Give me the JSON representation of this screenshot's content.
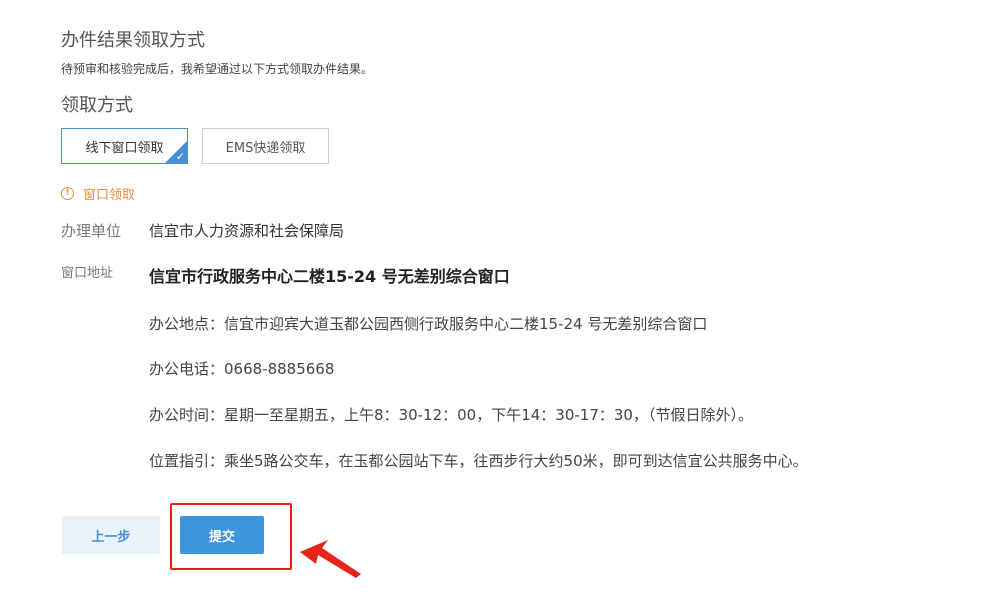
{
  "section": {
    "title": "办件结果领取方式",
    "description": "待预审和核验完成后，我希望通过以下方式领取办件结果。"
  },
  "pickup": {
    "label": "领取方式",
    "options": [
      {
        "label": "线下窗口领取",
        "selected": true
      },
      {
        "label": "EMS快递领取",
        "selected": false
      }
    ]
  },
  "notice": {
    "icon": "exclamation-circle-icon",
    "text": "窗口领取"
  },
  "office": {
    "unit_label": "办理单位",
    "unit_value": "信宜市人力资源和社会保障局",
    "address_label": "窗口地址",
    "window_name": "信宜市行政服务中心二楼15-24 号无差别综合窗口",
    "details": {
      "location": "办公地点：信宜市迎宾大道玉都公园西侧行政服务中心二楼15-24 号无差别综合窗口",
      "phone": "办公电话：0668-8885668",
      "hours": "办公时间：星期一至星期五，上午8：30-12：00，下午14：30-17：30，（节假日除外）。",
      "directions": "位置指引：乘坐5路公交车，在玉都公园站下车，往西步行大约50米，即可到达信宜公共服务中心。"
    }
  },
  "actions": {
    "prev_label": "上一步",
    "submit_label": "提交"
  },
  "colors": {
    "accent": "#4a90d9",
    "submit": "#3c95dd",
    "notice": "#e8913a",
    "annotation": "#e8231c"
  }
}
